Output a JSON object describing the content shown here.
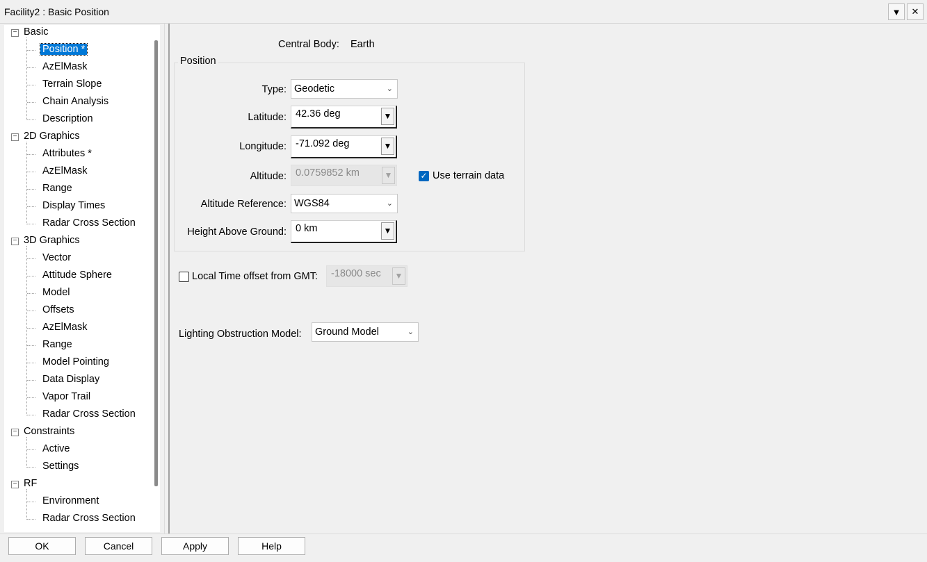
{
  "window": {
    "title": "Facility2 : Basic Position",
    "menu_glyph": "▼",
    "close_glyph": "✕"
  },
  "tree": {
    "groups": [
      {
        "label": "Basic",
        "children": [
          "Position *",
          "AzElMask",
          "Terrain Slope",
          "Chain Analysis",
          "Description"
        ]
      },
      {
        "label": "2D Graphics",
        "children": [
          "Attributes *",
          "AzElMask",
          "Range",
          "Display Times",
          "Radar Cross Section"
        ]
      },
      {
        "label": "3D Graphics",
        "children": [
          "Vector",
          "Attitude Sphere",
          "Model",
          "Offsets",
          "AzElMask",
          "Range",
          "Model Pointing",
          "Data Display",
          "Vapor Trail",
          "Radar Cross Section"
        ]
      },
      {
        "label": "Constraints",
        "children": [
          "Active",
          "Settings"
        ]
      },
      {
        "label": "RF",
        "children": [
          "Environment",
          "Radar Cross Section"
        ]
      }
    ],
    "selected": "Position *"
  },
  "panel": {
    "central_body_label": "Central Body:",
    "central_body_value": "Earth",
    "position_group": "Position",
    "type_label": "Type:",
    "type_value": "Geodetic",
    "latitude_label": "Latitude:",
    "latitude_value": "42.36 deg",
    "longitude_label": "Longitude:",
    "longitude_value": "-71.092 deg",
    "altitude_label": "Altitude:",
    "altitude_value": "0.0759852 km",
    "use_terrain_label": "Use terrain data",
    "use_terrain_checked": true,
    "alt_ref_label": "Altitude Reference:",
    "alt_ref_value": "WGS84",
    "hag_label": "Height Above Ground:",
    "hag_value": "0 km",
    "local_time_label": "Local Time offset from GMT:",
    "local_time_checked": false,
    "local_time_value": "-18000 sec",
    "lighting_label": "Lighting Obstruction Model:",
    "lighting_value": "Ground Model"
  },
  "buttons": {
    "ok": "OK",
    "cancel": "Cancel",
    "apply": "Apply",
    "help": "Help"
  },
  "icons": {
    "expander": "minus-box-icon",
    "unit_button": "unit-selector-icon",
    "dropdown": "chevron-down-icon"
  }
}
